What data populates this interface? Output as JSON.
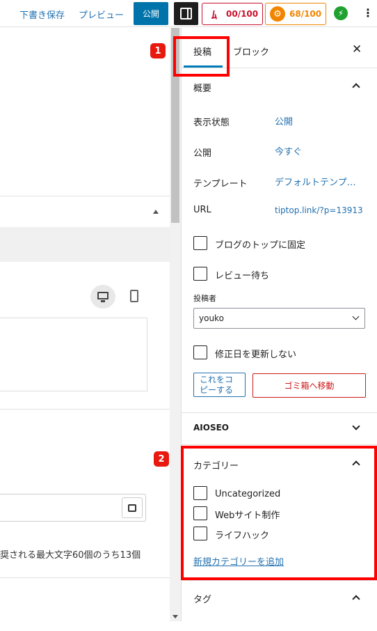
{
  "toolbar": {
    "save_draft": "下書き保存",
    "preview": "プレビュー",
    "publish": "公開",
    "seo_score": "00/100",
    "aioseo_score": "68/100"
  },
  "editor": {
    "char_count_text": "奨される最大文字60個のうち13個"
  },
  "sidebar": {
    "tabs": [
      "投稿",
      "ブロック"
    ],
    "summary": {
      "title": "概要",
      "visibility_label": "表示状態",
      "visibility_value": "公開",
      "publish_label": "公開",
      "publish_value": "今すぐ",
      "template_label": "テンプレート",
      "template_value": "デフォルトテンプ…",
      "url_label": "URL",
      "url_value": "tiptop.link/?p=13913",
      "sticky_label": "ブログのトップに固定",
      "pending_label": "レビュー待ち",
      "author_label": "投稿者",
      "author_value": "youko",
      "no_modified_label": "修正日を更新しない",
      "copy_button": "これをコピーする",
      "copy_line1": "これをコ",
      "copy_line2": "ピーする",
      "trash_button": "ゴミ箱へ移動"
    },
    "aioseo": {
      "title": "AIOSEO"
    },
    "categories": {
      "title": "カテゴリー",
      "items": [
        "Uncategorized",
        "Webサイト制作",
        "ライフハック"
      ],
      "add_new": "新規カテゴリーを追加"
    },
    "tags": {
      "title": "タグ"
    }
  },
  "annotations": {
    "badge1": "1",
    "badge2": "2"
  },
  "colors": {
    "accent": "#007cba",
    "link": "#2271b1",
    "annotation": "#ff0000",
    "danger": "#cc1818"
  }
}
